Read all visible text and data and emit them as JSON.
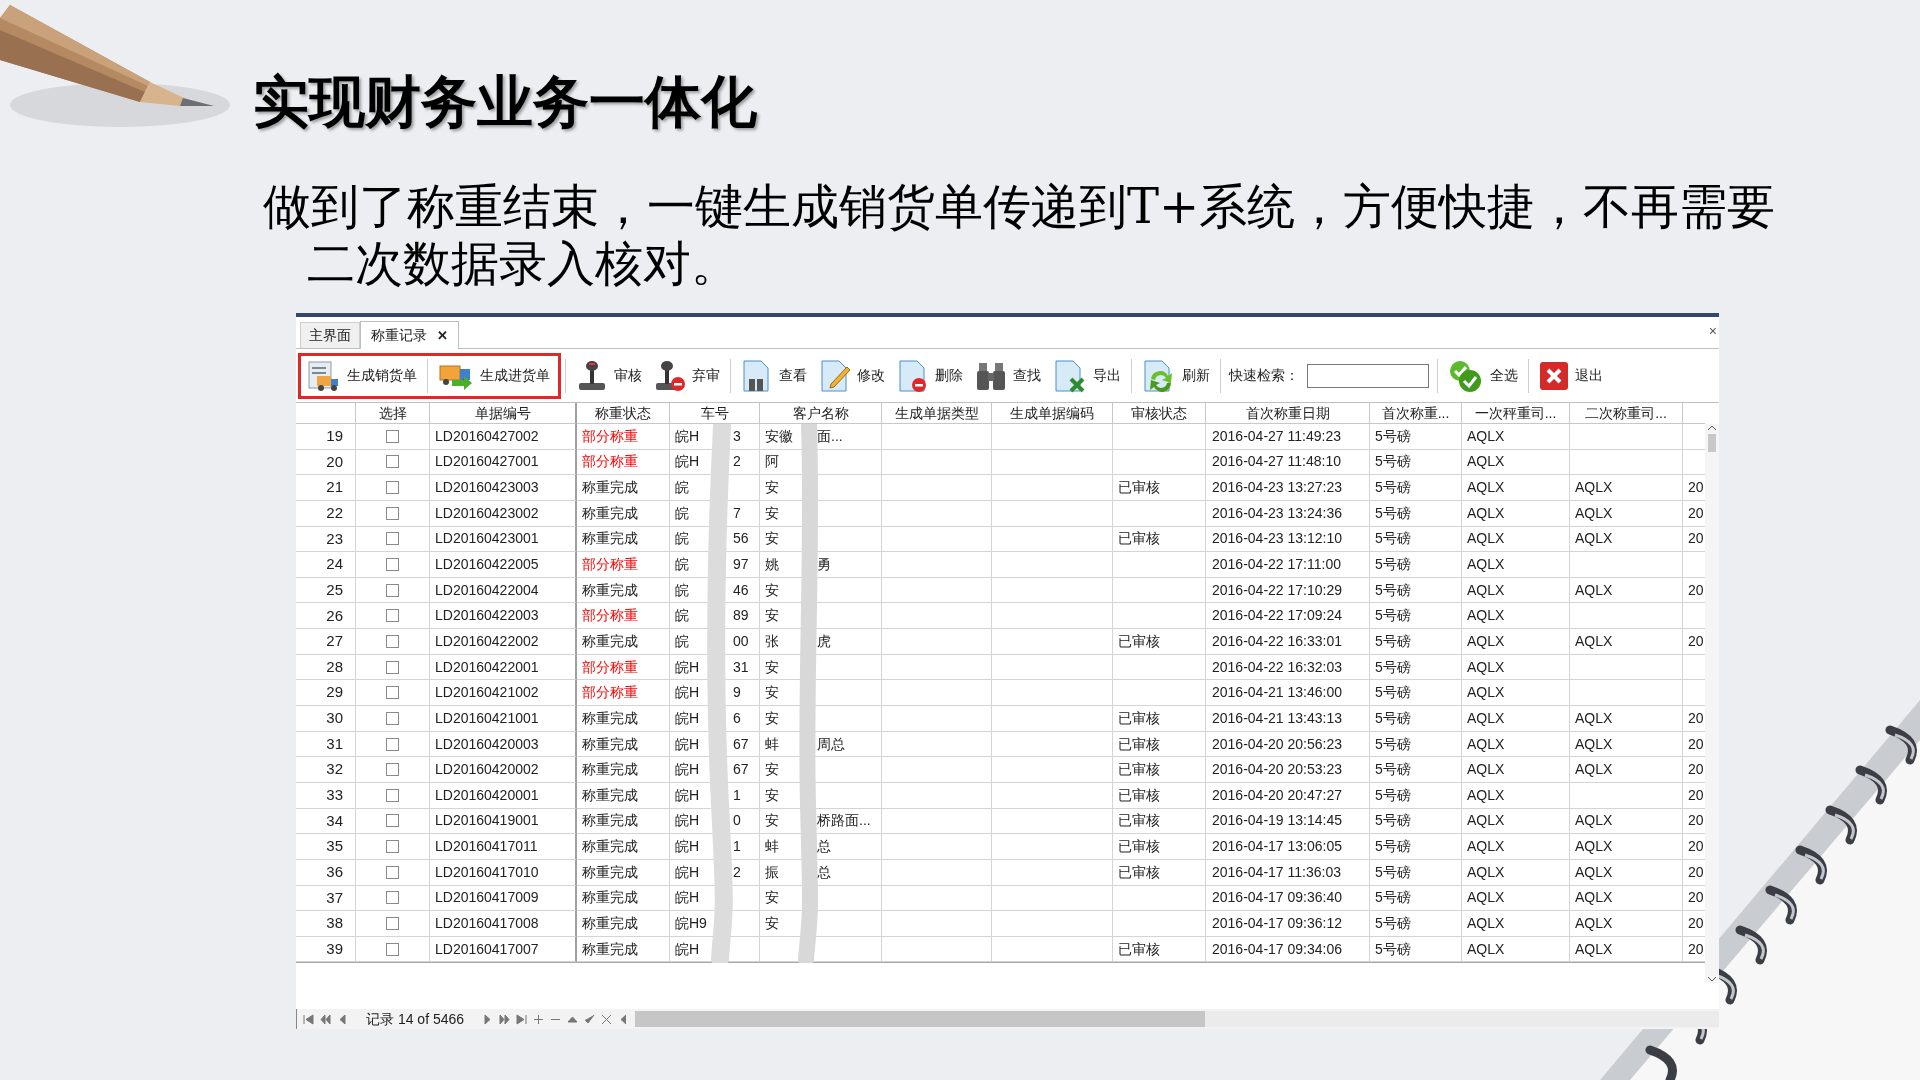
{
  "slide": {
    "title": "实现财务业务一体化",
    "body": "做到了称重结束，一键生成销货单传递到T+系统，方便快捷，不再需要二次数据录入核对。"
  },
  "window": {
    "tabs": [
      {
        "label": "主界面",
        "selected": false
      },
      {
        "label": "称重记录",
        "selected": true,
        "close": "✕"
      }
    ],
    "close": "×"
  },
  "toolbar": {
    "outlined_buttons": [
      "生成销货单",
      "生成进货单"
    ],
    "buttons": [
      "审核",
      "弃审",
      "查看",
      "修改",
      "删除",
      "查找",
      "导出",
      "刷新"
    ],
    "search": {
      "label": "快速检索："
    },
    "end_buttons": [
      "全选",
      "退出"
    ]
  },
  "table": {
    "columns": [
      "选择",
      "单据编号",
      "称重状态",
      "车号",
      "客户名称",
      "生成单据类型",
      "生成单据编码",
      "审核状态",
      "首次称重日期",
      "首次称重...",
      "一次秤重司...",
      "二次称重司..."
    ],
    "rows": [
      {
        "n": "19",
        "checked": false,
        "id": "LD20160427002",
        "status": "部分称重",
        "partial": true,
        "car_start": "皖H",
        "car_end": "3",
        "customer_start": "安徽",
        "customer_end": "面...",
        "date": "2016-04-27 11:49:23",
        "scale": "5号磅",
        "first": "AQLX"
      },
      {
        "n": "20",
        "checked": false,
        "id": "LD20160427001",
        "status": "部分称重",
        "partial": true,
        "car_start": "皖H",
        "car_end": "2",
        "customer_start": "阿",
        "date": "2016-04-27 11:48:10",
        "scale": "5号磅",
        "first": "AQLX"
      },
      {
        "n": "21",
        "checked": false,
        "id": "LD20160423003",
        "status": "称重完成",
        "partial": false,
        "car_start": "皖",
        "customer_start": "安",
        "audit": "已审核",
        "date": "2016-04-23 13:27:23",
        "scale": "5号磅",
        "first": "AQLX",
        "second": "AQLX",
        "column_14": "20"
      },
      {
        "n": "22",
        "checked": false,
        "id": "LD20160423002",
        "status": "称重完成",
        "partial": false,
        "car_start": "皖",
        "car_end": "7",
        "customer_start": "安",
        "date": "2016-04-23 13:24:36",
        "scale": "5号磅",
        "first": "AQLX",
        "second": "AQLX",
        "column_14": "20"
      },
      {
        "n": "23",
        "checked": false,
        "id": "LD20160423001",
        "status": "称重完成",
        "partial": false,
        "car_start": "皖",
        "car_end": "56",
        "customer_start": "安",
        "audit": "已审核",
        "date": "2016-04-23 13:12:10",
        "scale": "5号磅",
        "first": "AQLX",
        "second": "AQLX",
        "column_14": "20"
      },
      {
        "n": "24",
        "checked": false,
        "id": "LD20160422005",
        "status": "部分称重",
        "partial": true,
        "car_start": "皖",
        "car_end": "97",
        "customer_start": "姚",
        "customer_end": "勇",
        "date": "2016-04-22 17:11:00",
        "scale": "5号磅",
        "first": "AQLX"
      },
      {
        "n": "25",
        "checked": false,
        "id": "LD20160422004",
        "status": "称重完成",
        "partial": false,
        "car_start": "皖",
        "car_end": "46",
        "customer_start": "安",
        "date": "2016-04-22 17:10:29",
        "scale": "5号磅",
        "first": "AQLX",
        "second": "AQLX",
        "column_14": "20"
      },
      {
        "n": "26",
        "checked": false,
        "id": "LD20160422003",
        "status": "部分称重",
        "partial": true,
        "car_start": "皖",
        "car_end": "89",
        "customer_start": "安",
        "date": "2016-04-22 17:09:24",
        "scale": "5号磅",
        "first": "AQLX"
      },
      {
        "n": "27",
        "checked": false,
        "id": "LD20160422002",
        "status": "称重完成",
        "partial": false,
        "car_start": "皖",
        "car_end": "00",
        "customer_start": "张",
        "customer_end": "虎",
        "audit": "已审核",
        "date": "2016-04-22 16:33:01",
        "scale": "5号磅",
        "first": "AQLX",
        "second": "AQLX",
        "column_14": "20"
      },
      {
        "n": "28",
        "checked": false,
        "id": "LD20160422001",
        "status": "部分称重",
        "partial": true,
        "car_start": "皖H",
        "car_end": "31",
        "customer_start": "安",
        "date": "2016-04-22 16:32:03",
        "scale": "5号磅",
        "first": "AQLX"
      },
      {
        "n": "29",
        "checked": false,
        "id": "LD20160421002",
        "status": "部分称重",
        "partial": true,
        "car_start": "皖H",
        "car_end": "9",
        "customer_start": "安",
        "date": "2016-04-21 13:46:00",
        "scale": "5号磅",
        "first": "AQLX"
      },
      {
        "n": "30",
        "checked": false,
        "id": "LD20160421001",
        "status": "称重完成",
        "partial": false,
        "car_start": "皖H",
        "car_end": "6",
        "customer_start": "安",
        "audit": "已审核",
        "date": "2016-04-21 13:43:13",
        "scale": "5号磅",
        "first": "AQLX",
        "second": "AQLX",
        "column_14": "20"
      },
      {
        "n": "31",
        "checked": false,
        "id": "LD20160420003",
        "status": "称重完成",
        "partial": false,
        "car_start": "皖H",
        "car_end": "67",
        "customer_start": "蚌",
        "customer_end": "周总",
        "audit": "已审核",
        "date": "2016-04-20 20:56:23",
        "scale": "5号磅",
        "first": "AQLX",
        "second": "AQLX",
        "column_14": "20"
      },
      {
        "n": "32",
        "checked": false,
        "id": "LD20160420002",
        "status": "称重完成",
        "partial": false,
        "car_start": "皖H",
        "car_end": "67",
        "customer_start": "安",
        "audit": "已审核",
        "date": "2016-04-20 20:53:23",
        "scale": "5号磅",
        "first": "AQLX",
        "second": "AQLX",
        "column_14": "20"
      },
      {
        "n": "33",
        "checked": false,
        "id": "LD20160420001",
        "status": "称重完成",
        "partial": false,
        "car_start": "皖H",
        "car_end": "1",
        "customer_start": "安",
        "audit": "已审核",
        "date": "2016-04-20 20:47:27",
        "scale": "5号磅",
        "first": "AQLX",
        "column_14": "20"
      },
      {
        "n": "34",
        "checked": false,
        "id": "LD20160419001",
        "status": "称重完成",
        "partial": false,
        "car_start": "皖H",
        "car_end": "0",
        "customer_start": "安",
        "customer_end": "桥路面...",
        "audit": "已审核",
        "date": "2016-04-19 13:14:45",
        "scale": "5号磅",
        "first": "AQLX",
        "second": "AQLX",
        "column_14": "20"
      },
      {
        "n": "35",
        "checked": false,
        "id": "LD20160417011",
        "status": "称重完成",
        "partial": false,
        "car_start": "皖H",
        "car_end": "1",
        "customer_start": "蚌",
        "customer_end": "总",
        "audit": "已审核",
        "date": "2016-04-17 13:06:05",
        "scale": "5号磅",
        "first": "AQLX",
        "second": "AQLX",
        "column_14": "20"
      },
      {
        "n": "36",
        "checked": false,
        "id": "LD20160417010",
        "status": "称重完成",
        "partial": false,
        "car_start": "皖H",
        "car_end": "2",
        "customer_start": "振",
        "customer_end": "总",
        "audit": "已审核",
        "date": "2016-04-17 11:36:03",
        "scale": "5号磅",
        "first": "AQLX",
        "second": "AQLX",
        "column_14": "20"
      },
      {
        "n": "37",
        "checked": false,
        "id": "LD20160417009",
        "status": "称重完成",
        "partial": false,
        "car_start": "皖H",
        "customer_start": "安",
        "date": "2016-04-17 09:36:40",
        "scale": "5号磅",
        "first": "AQLX",
        "second": "AQLX",
        "column_14": "20"
      },
      {
        "n": "38",
        "checked": false,
        "id": "LD20160417008",
        "status": "称重完成",
        "partial": false,
        "car_start": "皖H9",
        "customer_start": "安",
        "date": "2016-04-17 09:36:12",
        "scale": "5号磅",
        "first": "AQLX",
        "second": "AQLX",
        "column_14": "20"
      },
      {
        "n": "39",
        "checked": false,
        "id": "LD20160417007",
        "status": "称重完成",
        "partial": false,
        "car_start": "皖H",
        "audit": "已审核",
        "date": "2016-04-17 09:34:06",
        "scale": "5号磅",
        "first": "AQLX",
        "second": "AQLX",
        "column_14": "20"
      }
    ]
  },
  "navigator": {
    "record": "记录 14 of 5466"
  }
}
